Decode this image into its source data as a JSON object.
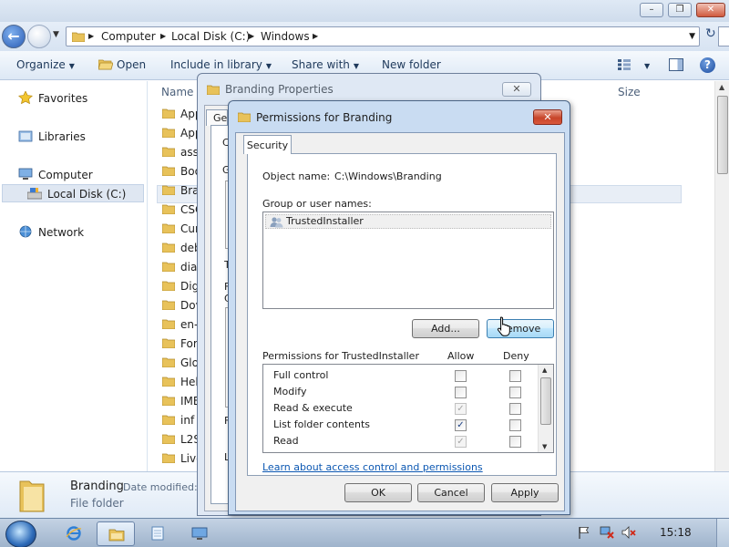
{
  "explorer": {
    "breadcrumbs": [
      "Computer",
      "Local Disk (C:)",
      "Windows"
    ],
    "toolbar": {
      "organize": "Organize",
      "open": "Open",
      "include_in_library": "Include in library",
      "share_with": "Share with",
      "new_folder": "New folder"
    },
    "nav_pane": {
      "favorites": "Favorites",
      "libraries": "Libraries",
      "computer": "Computer",
      "local_disk": "Local Disk (C:)",
      "network": "Network"
    },
    "columns": {
      "name": "Name",
      "size": "Size"
    },
    "files": [
      "App",
      "App",
      "asse",
      "Boo",
      "Bra",
      "CSC",
      "Cur",
      "deb",
      "diag",
      "Dig",
      "Dov",
      "en-",
      "For",
      "Glo",
      "Hel",
      "IME",
      "inf",
      "L2S",
      "Live"
    ],
    "details_pane": {
      "name": "Branding",
      "date_label": "Date modified:",
      "type": "File folder"
    }
  },
  "properties_window": {
    "title": "Branding Properties",
    "tab_partial": "Ge",
    "letters": [
      "C",
      "G",
      "T",
      "F",
      "C",
      "F",
      "L"
    ]
  },
  "permissions_dialog": {
    "title": "Permissions for Branding",
    "tab": "Security",
    "object_name_label": "Object name:",
    "object_name_value": "C:\\Windows\\Branding",
    "group_label": "Group or user names:",
    "groups": [
      "TrustedInstaller"
    ],
    "add_button": "Add...",
    "remove_button": "Remove",
    "permissions_label": "Permissions for TrustedInstaller",
    "allow_label": "Allow",
    "deny_label": "Deny",
    "permissions": [
      {
        "name": "Full control",
        "allow": false,
        "allow_disabled": false,
        "deny": false
      },
      {
        "name": "Modify",
        "allow": false,
        "allow_disabled": false,
        "deny": false
      },
      {
        "name": "Read & execute",
        "allow": true,
        "allow_disabled": true,
        "deny": false
      },
      {
        "name": "List folder contents",
        "allow": true,
        "allow_disabled": false,
        "deny": false
      },
      {
        "name": "Read",
        "allow": true,
        "allow_disabled": true,
        "deny": false
      }
    ],
    "link": "Learn about access control and permissions",
    "ok_button": "OK",
    "cancel_button": "Cancel",
    "apply_button": "Apply"
  },
  "taskbar": {
    "clock": "15:18"
  },
  "colors": {
    "accent": "#2a5cb5",
    "close_red": "#c7452a",
    "link": "#0b57b2",
    "folder_yellow": "#e8c25a"
  }
}
